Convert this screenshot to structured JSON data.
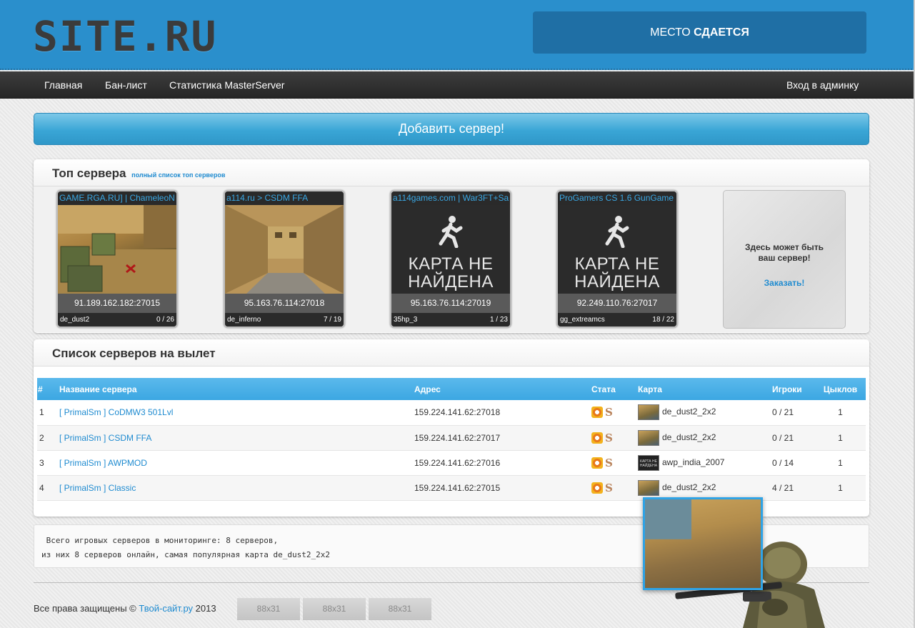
{
  "header": {
    "logo": "SITE.RU",
    "ad_plain": "МЕСТО ",
    "ad_bold": "СДАЕТСЯ"
  },
  "nav": {
    "items": [
      "Главная",
      "Бан-лист",
      "Статистика MasterServer"
    ],
    "admin": "Вход в админку"
  },
  "add_server": "Добавить сервер!",
  "top": {
    "title": "Топ сервера",
    "full_list_link": "полный список топ серверов",
    "cards": [
      {
        "name": "GAME.RGA.RU] | ChameleoN",
        "ip": "91.189.162.182:27015",
        "map": "de_dust2",
        "players": "0 / 26"
      },
      {
        "name": "a114.ru > CSDM FFA",
        "ip": "95.163.76.114:27018",
        "map": "de_inferno",
        "players": "7 / 19"
      },
      {
        "name": "a114games.com | War3FT+Sa",
        "ip": "95.163.76.114:27019",
        "map": "35hp_3",
        "players": "1 / 23",
        "nomap": "КАРТА НЕ НАЙДЕНА"
      },
      {
        "name": "ProGamers CS 1.6 GunGame",
        "ip": "92.249.110.76:27017",
        "map": "gg_extreamcs",
        "players": "18 / 22",
        "nomap": "КАРТА НЕ НАЙДЕНА"
      }
    ],
    "promo_line1": "Здесь может быть",
    "promo_line2": "ваш сервер!",
    "promo_order": "Заказать!"
  },
  "list": {
    "title": "Список серверов на вылет",
    "headers": [
      "#",
      "Название сервера",
      "Адрес",
      "Стата",
      "Карта",
      "Игроки",
      "Цыклов"
    ],
    "rows": [
      {
        "n": "1",
        "name": "[ PrimalSm ] CoDMW3 501Lvl",
        "addr": "159.224.141.62:27018",
        "map": "de_dust2_2x2",
        "players": "0 / 21",
        "cycles": "1"
      },
      {
        "n": "2",
        "name": "[ PrimalSm ] CSDM FFA",
        "addr": "159.224.141.62:27017",
        "map": "de_dust2_2x2",
        "players": "0 / 21",
        "cycles": "1"
      },
      {
        "n": "3",
        "name": "[ PrimalSm ] AWPMOD",
        "addr": "159.224.141.62:27016",
        "map": "awp_india_2007",
        "players": "0 / 14",
        "cycles": "1"
      },
      {
        "n": "4",
        "name": "[ PrimalSm ] Classic",
        "addr": "159.224.141.62:27015",
        "map": "de_dust2_2x2",
        "players": "4 / 21",
        "cycles": "1"
      }
    ],
    "stat_s": "S",
    "thumb_nomap": "КАРТА НЕ НАЙДЕНА"
  },
  "stats": {
    "line1": " Всего игровых серверов в мониторинге: 8 серверов,",
    "line2": "из них 8 серверов онлайн, самая популярная карта de_dust2_2x2"
  },
  "footer": {
    "copyright": "Все права защищены © ",
    "site_link": "Твой-сайт.ру",
    "year": " 2013",
    "buttons": [
      "88x31",
      "88x31",
      "88x31"
    ]
  }
}
